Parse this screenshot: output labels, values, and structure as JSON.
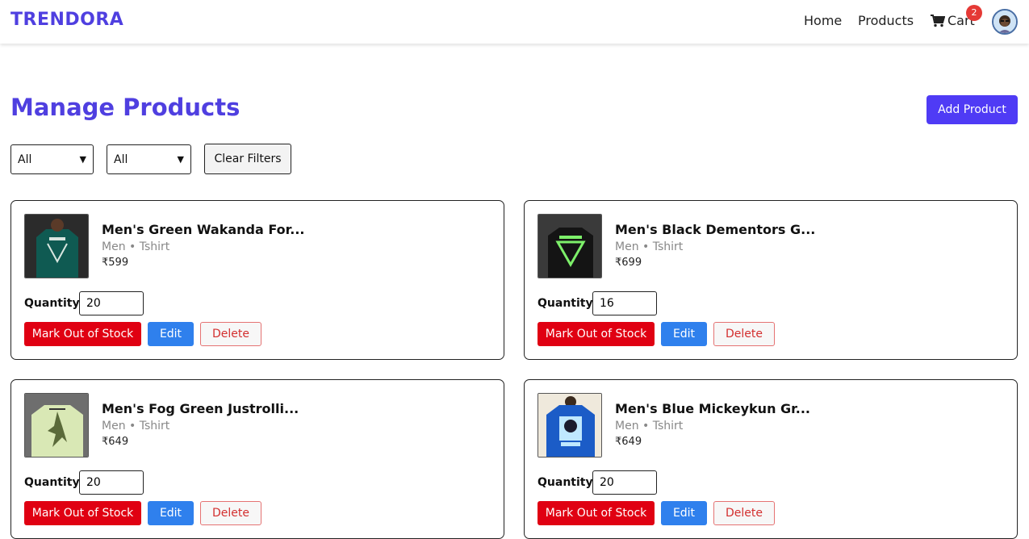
{
  "navbar": {
    "brand": "TRENDORA",
    "links": {
      "home": "Home",
      "products": "Products",
      "cart": "Cart"
    },
    "cart_count": "2",
    "cart_icon": "shopping-cart-icon",
    "avatar_icon": "user-avatar"
  },
  "page": {
    "title": "Manage Products",
    "add_button": "Add Product"
  },
  "filters": {
    "gender_select": "All",
    "category_select": "All",
    "clear_button": "Clear Filters"
  },
  "labels": {
    "quantity": "Quantity:",
    "mark_out_of_stock": "Mark Out of Stock",
    "edit": "Edit",
    "delete": "Delete"
  },
  "products": [
    {
      "name": "Men's Green Wakanda For...",
      "category": "Men • Tshirt",
      "price": "₹599",
      "quantity": "20",
      "thumb_color": "#0f5a52"
    },
    {
      "name": "Men's Black Dementors G...",
      "category": "Men • Tshirt",
      "price": "₹699",
      "quantity": "16",
      "thumb_color": "#1a1a1a"
    },
    {
      "name": "Men's Fog Green Justrolli...",
      "category": "Men • Tshirt",
      "price": "₹649",
      "quantity": "20",
      "thumb_color": "#d9e8b5"
    },
    {
      "name": "Men's Blue Mickeykun Gr...",
      "category": "Men • Tshirt",
      "price": "₹649",
      "quantity": "20",
      "thumb_color": "#1b5cc7"
    }
  ],
  "colors": {
    "brand": "#4f3fe0",
    "primary_button": "#4f3bf5",
    "danger": "#e00012",
    "edit": "#2f80ed"
  }
}
